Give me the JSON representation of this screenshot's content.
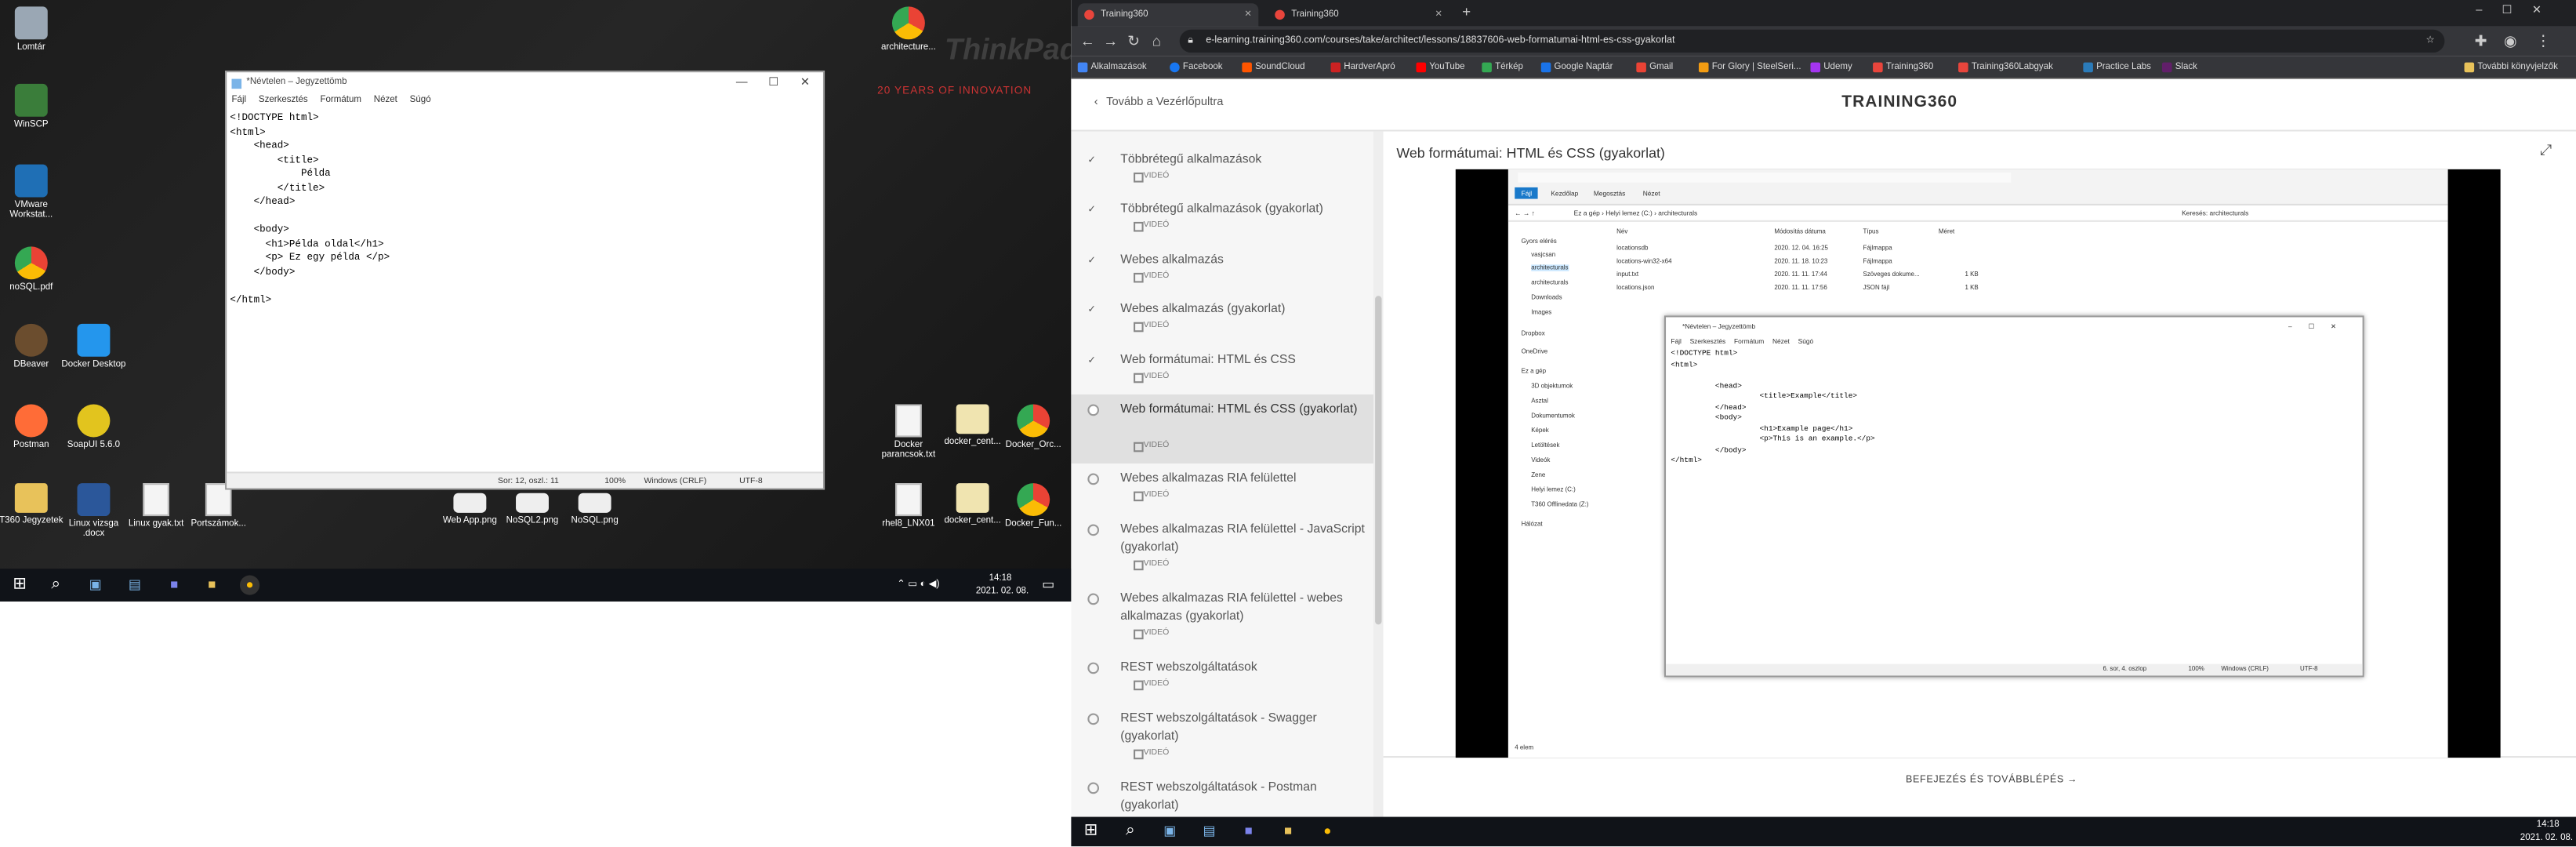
{
  "desktop": {
    "icons": [
      {
        "label": "Lomtár"
      },
      {
        "label": "WinSCP"
      },
      {
        "label": "VMware Workstat..."
      },
      {
        "label": "noSQL.pdf"
      },
      {
        "label": "DBeaver"
      },
      {
        "label": "Docker Desktop"
      },
      {
        "label": "Postman"
      },
      {
        "label": "SoapUI 5.6.0"
      },
      {
        "label": "T360 Jegyzetek"
      },
      {
        "label": "Linux vizsga .docx"
      },
      {
        "label": "Linux gyak.txt"
      },
      {
        "label": "Portszámok..."
      },
      {
        "label": "architecture..."
      },
      {
        "label": "Web App.png"
      },
      {
        "label": "NoSQL2.png"
      },
      {
        "label": "NoSQL.png"
      },
      {
        "label": "Docker parancsok.txt"
      },
      {
        "label": "docker_cent..."
      },
      {
        "label": "Docker_Orc..."
      },
      {
        "label": "rhel8_LNX01"
      },
      {
        "label": "docker_cent..."
      },
      {
        "label": "Docker_Fun..."
      }
    ],
    "wallpaper_text": {
      "brand": "ThinkPad",
      "tagline": "20 YEARS OF INNOVATION"
    },
    "taskbar": {
      "time": "14:18",
      "date": "2021. 02. 08."
    }
  },
  "notepad": {
    "title": "*Névtelen – Jegyzettömb",
    "menu": [
      "Fájl",
      "Szerkesztés",
      "Formátum",
      "Nézet",
      "Súgó"
    ],
    "content": "<!DOCTYPE html>\n<html>\n    <head>\n        <title>\n            Példa\n        </title>\n    </head>\n\n    <body>\n      <h1>Példa oldal</h1>\n      <p> Ez egy példa </p>\n    </body>\n\n</html>",
    "status": {
      "position": "Sor: 12, oszl.: 11",
      "zoom": "100%",
      "eol": "Windows (CRLF)",
      "encoding": "UTF-8"
    }
  },
  "browser": {
    "tabs": [
      {
        "label": "Training360"
      },
      {
        "label": "Training360"
      }
    ],
    "url": "e-learning.training360.com/courses/take/architect/lessons/18837606-web-formatumai-html-es-css-gyakorlat",
    "bookmarks": [
      {
        "label": "Alkalmazások",
        "color": "#4285f4"
      },
      {
        "label": "Facebook",
        "color": "#1877f2"
      },
      {
        "label": "SoundCloud",
        "color": "#ff5500"
      },
      {
        "label": "HardverApró",
        "color": "#cc2222"
      },
      {
        "label": "YouTube",
        "color": "#ff0000"
      },
      {
        "label": "Térkép",
        "color": "#34a853"
      },
      {
        "label": "Google Naptár",
        "color": "#1a73e8"
      },
      {
        "label": "Gmail",
        "color": "#ea4335"
      },
      {
        "label": "For Glory | SteelSeri...",
        "color": "#f39c12"
      },
      {
        "label": "Udemy",
        "color": "#a435f0"
      },
      {
        "label": "Training360",
        "color": "#e8453c"
      },
      {
        "label": "Training360Labgyak",
        "color": "#e8453c"
      },
      {
        "label": "Practice Labs",
        "color": "#2b7bb9"
      },
      {
        "label": "Slack",
        "color": "#611f69"
      },
      {
        "label": "További könyvjelzők",
        "color": "#e8c25a"
      }
    ],
    "page": {
      "back_label": "Tovább a Vezérlőpultra",
      "logo": "TRAINING360",
      "lesson_title": "Web formátumai: HTML és CSS (gyakorlat)",
      "next_button": "BEFEJEZÉS ÉS TOVÁBBLÉPÉS →",
      "type_label": "VIDEÓ",
      "lessons": [
        {
          "title": "Többrétegű alkalmazások",
          "done": true
        },
        {
          "title": "Többrétegű alkalmazások (gyakorlat)",
          "done": true
        },
        {
          "title": "Webes alkalmazás",
          "done": true
        },
        {
          "title": "Webes alkalmazás (gyakorlat)",
          "done": true
        },
        {
          "title": "Web formátumai: HTML és CSS",
          "done": true
        },
        {
          "title": "Web formátumai: HTML és CSS (gyakorlat)",
          "done": false,
          "active": true
        },
        {
          "title": "Webes alkalmazas RIA felülettel",
          "done": false
        },
        {
          "title": "Webes alkalmazas RIA felülettel - JavaScript (gyakorlat)",
          "done": false
        },
        {
          "title": "Webes alkalmazas RIA felülettel - webes alkalmazas (gyakorlat)",
          "done": false
        },
        {
          "title": "REST webszolgáltatások",
          "done": false
        },
        {
          "title": "REST webszolgáltatások - Swagger (gyakorlat)",
          "done": false
        },
        {
          "title": "REST webszolgáltatások - Postman (gyakorlat)",
          "done": false
        }
      ]
    },
    "video": {
      "explorer": {
        "ribbon": [
          "Fájl",
          "Kezdőlap",
          "Megosztás",
          "Nézet"
        ],
        "path": "Ez a gép › Helyi lemez (C:) › architecturals",
        "search": "Keresés: architecturals",
        "headers": [
          "Név",
          "Módosítás dátuma",
          "Típus",
          "Méret"
        ],
        "sidebar": [
          "Gyors elérés",
          "vasjcsan",
          "architecturals",
          "architecturals",
          "Downloads",
          "Images",
          "Dropbox",
          "OneDrive",
          "Ez a gép",
          "3D objektumok",
          "Asztal",
          "Dokumentumok",
          "Képek",
          "Letöltések",
          "Videók",
          "Zene",
          "Helyi lemez (C:)",
          "T360 Offlinedata (Z:)",
          "Hálózat"
        ],
        "files": [
          {
            "name": "locationsdb",
            "date": "2020. 12. 04. 16:25",
            "type": "Fájlmappa",
            "size": ""
          },
          {
            "name": "locations-win32-x64",
            "date": "2020. 11. 18. 10:23",
            "type": "Fájlmappa",
            "size": ""
          },
          {
            "name": "input.txt",
            "date": "2020. 11. 11. 17:44",
            "type": "Szöveges dokume...",
            "size": "1 KB"
          },
          {
            "name": "locations.json",
            "date": "2020. 11. 11. 17:56",
            "type": "JSON fájl",
            "size": "1 KB"
          }
        ],
        "items_count": "4 elem"
      },
      "notepad": {
        "title": "*Névtelen – Jegyzettömb",
        "menu": [
          "Fájl",
          "Szerkesztés",
          "Formátum",
          "Nézet",
          "Súgó"
        ],
        "content": "<!DOCTYPE html>\n<html>\n\n          <head>\n                    <title>Example</title>\n          </head>\n          <body>\n                    <h1>Example page</h1>\n                    <p>This is an example.</p>\n          </body>\n</html>",
        "status": {
          "position": "6. sor, 4. oszlop",
          "zoom": "100%",
          "eol": "Windows (CRLF)",
          "encoding": "UTF-8"
        }
      }
    }
  },
  "taskbar2": {
    "time": "14:18",
    "date": "2021. 02. 08."
  }
}
